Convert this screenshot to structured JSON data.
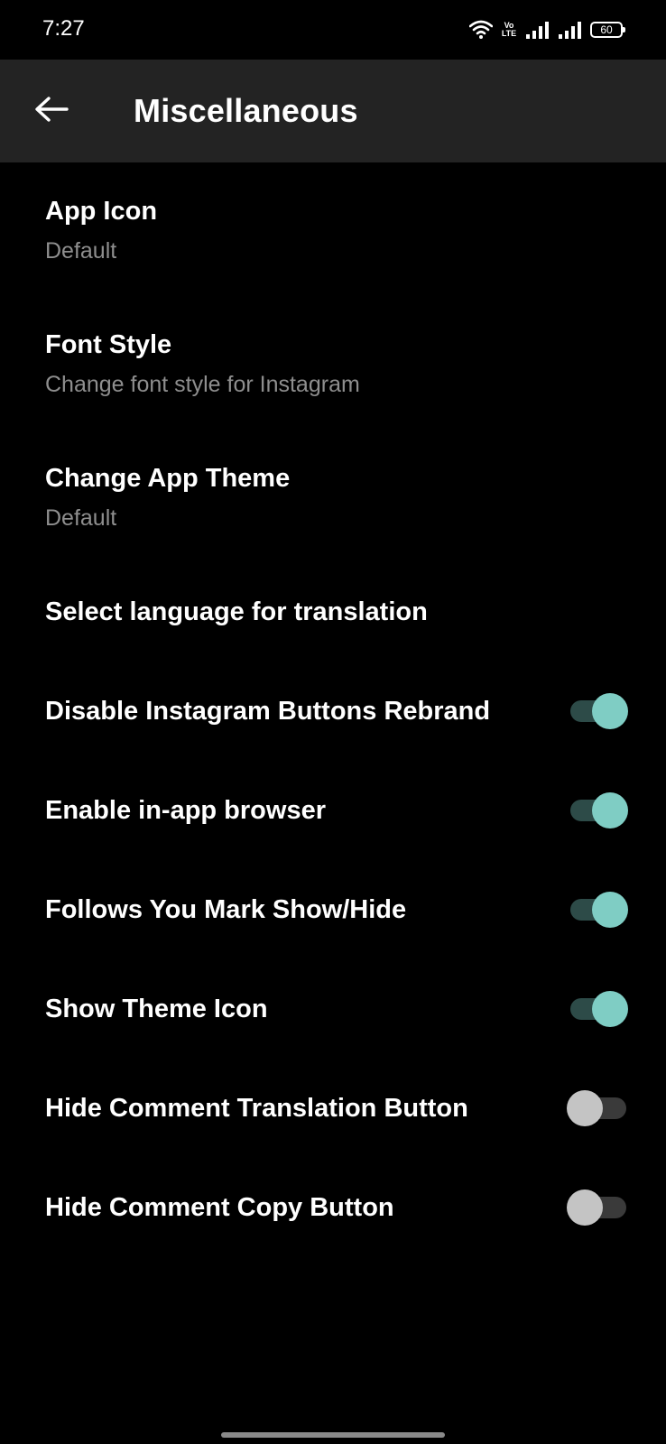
{
  "status_bar": {
    "time": "7:27",
    "volte_line1": "Vo",
    "volte_line2": "LTE",
    "battery": "60"
  },
  "app_bar": {
    "title": "Miscellaneous"
  },
  "settings": {
    "app_icon": {
      "title": "App Icon",
      "subtitle": "Default"
    },
    "font_style": {
      "title": "Font Style",
      "subtitle": "Change font style for Instagram"
    },
    "app_theme": {
      "title": "Change App Theme",
      "subtitle": "Default"
    },
    "translation_language": {
      "title": "Select language for translation"
    },
    "toggles": [
      {
        "label": "Disable Instagram Buttons Rebrand",
        "on": true
      },
      {
        "label": "Enable in-app browser",
        "on": true
      },
      {
        "label": "Follows You Mark Show/Hide",
        "on": true
      },
      {
        "label": "Show Theme Icon",
        "on": true
      },
      {
        "label": "Hide Comment Translation Button",
        "on": false
      },
      {
        "label": "Hide Comment Copy Button",
        "on": false
      }
    ]
  },
  "colors": {
    "background": "#000000",
    "app_bar": "#232323",
    "toggle_on_thumb": "#7fcdc4",
    "toggle_on_track": "#2d4b48",
    "toggle_off_thumb": "#c4c4c4",
    "toggle_off_track": "#3a3a3a",
    "subtitle": "#8e8e8e"
  },
  "icons": {
    "back": "arrow-left-icon",
    "wifi": "wifi-icon",
    "signal": "signal-icon",
    "battery": "battery-icon"
  }
}
